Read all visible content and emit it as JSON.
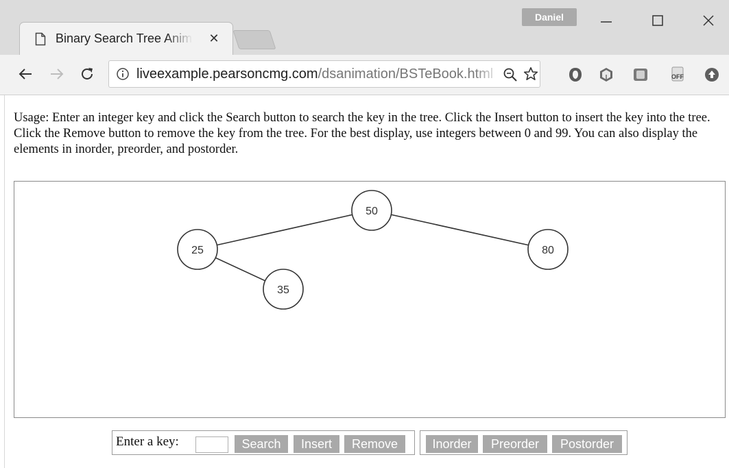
{
  "window": {
    "profile_name": "Daniel"
  },
  "tab": {
    "title": "Binary Search Tree Animation"
  },
  "toolbar": {
    "url_host": "liveexample.pearsoncmg.com",
    "url_path": "/dsanimation/BSTeBook.html",
    "extension_off_label": "OFF"
  },
  "page": {
    "usage_text": "Usage: Enter an integer key and click the Search button to search the key in the tree. Click the Insert button to insert the key into the tree. Click the Remove button to remove the key from the tree. For the best display, use integers between 0 and 99. You can also display the elements in inorder, preorder, and postorder.",
    "tree": {
      "nodes": [
        {
          "key": "50",
          "depth": 0,
          "order": 3
        },
        {
          "key": "25",
          "depth": 1,
          "order": 1
        },
        {
          "key": "80",
          "depth": 1,
          "order": 4
        },
        {
          "key": "35",
          "depth": 2,
          "order": 2
        }
      ],
      "edges": [
        {
          "from": "50",
          "to": "25"
        },
        {
          "from": "50",
          "to": "80"
        },
        {
          "from": "25",
          "to": "35"
        }
      ]
    },
    "controls": {
      "key_label": "Enter a key:",
      "key_value": "",
      "search_label": "Search",
      "insert_label": "Insert",
      "remove_label": "Remove",
      "inorder_label": "Inorder",
      "preorder_label": "Preorder",
      "postorder_label": "Postorder"
    }
  },
  "colors": {
    "button_bg": "#a9a9a9",
    "button_text": "#ffffff",
    "node_stroke": "#333333",
    "edge_stroke": "#333333"
  }
}
